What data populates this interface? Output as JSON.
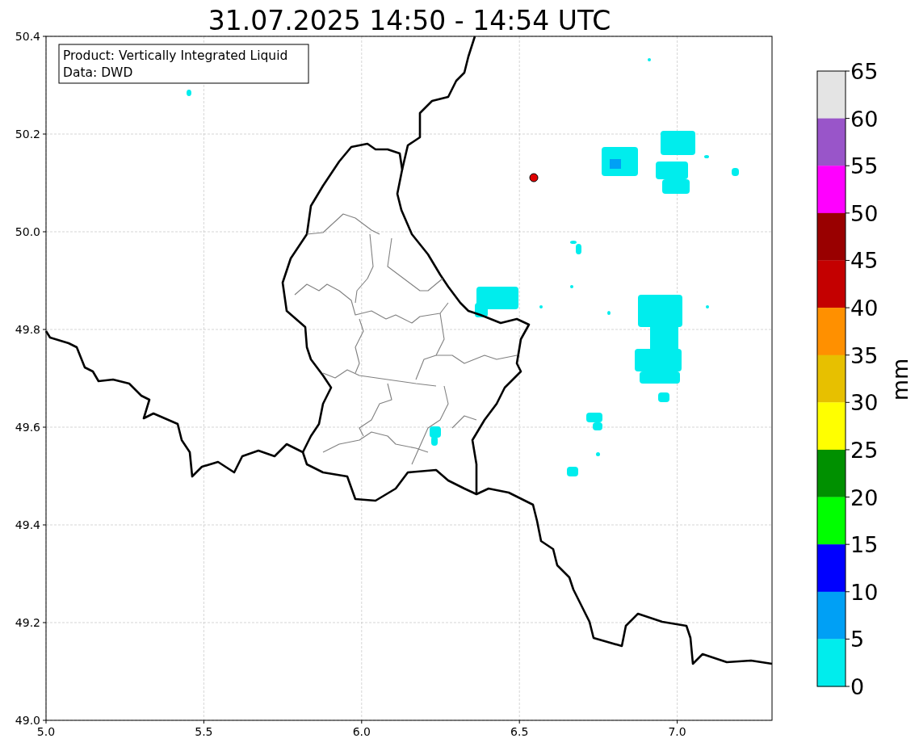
{
  "title": "31.07.2025 14:50 - 14:54 UTC",
  "info_box": {
    "lines": [
      "Product: Vertically Integrated Liquid",
      "Data: DWD"
    ]
  },
  "map": {
    "x_ticks": [
      "5.0",
      "5.5",
      "6.0",
      "6.5",
      "7.0"
    ],
    "y_ticks": [
      "50.4",
      "50.2",
      "50.0",
      "49.8",
      "49.6",
      "49.4",
      "49.2",
      "49.0"
    ]
  },
  "colorbar": {
    "label": "mm",
    "ticks": [
      "65",
      "60",
      "55",
      "50",
      "45",
      "40",
      "35",
      "30",
      "25",
      "20",
      "15",
      "10",
      "5",
      "0"
    ],
    "bins": [
      {
        "color": "#e4e4e4"
      },
      {
        "color": "#9955c9"
      },
      {
        "color": "#ff00ff"
      },
      {
        "color": "#990000"
      },
      {
        "color": "#c40000"
      },
      {
        "color": "#ff9000"
      },
      {
        "color": "#e7c000"
      },
      {
        "color": "#ffff00"
      },
      {
        "color": "#009000"
      },
      {
        "color": "#00ff00"
      },
      {
        "color": "#0000ff"
      },
      {
        "color": "#00a0f5"
      },
      {
        "color": "#00eded"
      }
    ]
  }
}
